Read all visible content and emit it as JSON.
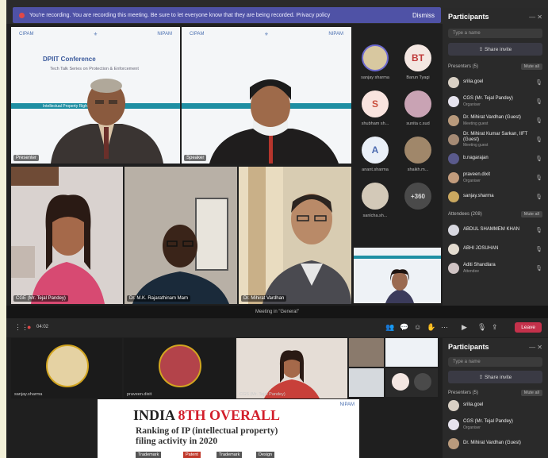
{
  "banner": {
    "text": "You're recording. You are recording this meeting. Be sure to let everyone know that they are being recorded. Privacy policy",
    "dismiss": "Dismiss"
  },
  "video_tiles": [
    {
      "name": "Presenter",
      "type": "slide"
    },
    {
      "name": "Speaker",
      "type": "slide"
    },
    {
      "name": "CGE (Mr. Tejal Pandey)",
      "type": "camera"
    },
    {
      "name": "Dr. M.K. Rajarathinam Mam",
      "type": "camera"
    },
    {
      "name": "Dr. Mihirat Vardhan",
      "type": "camera"
    }
  ],
  "slide_top": {
    "heading": "DPIIT Conference",
    "subtitle": "Tech Talk Series on Protection & Enforcement",
    "bar_label": "Intellectual Property Rights & Design Patent"
  },
  "avatars": [
    {
      "label": "sanjay sharma",
      "initials": "",
      "color": "#d8c8a0"
    },
    {
      "label": "Barun Tyagi",
      "initials": "BT",
      "color": "#f4e7e2"
    },
    {
      "label": "shubham sh...",
      "initials": "S",
      "color": "#f9e4df"
    },
    {
      "label": "sunita c.sud",
      "initials": "",
      "color": "#c9a3b4"
    },
    {
      "label": "anant.sharma",
      "initials": "A",
      "color": "#eaf0f8"
    },
    {
      "label": "shaikh.m...",
      "initials": "",
      "color": "#a0876a"
    },
    {
      "label": "sanlcha.sh...",
      "initials": "",
      "color": "#d3c9b8"
    },
    {
      "label": "+360",
      "initials": "+360",
      "color": "#4a4a4a"
    }
  ],
  "participants_panel": {
    "title": "Participants",
    "search_placeholder": "Type a name",
    "share_invite": "Share invite",
    "presenters_header": "Presenters (5)",
    "attendees_header": "Attendees (208)",
    "mute_all": "Mute all",
    "presenters": [
      {
        "name": "srilia.goel",
        "role": ""
      },
      {
        "name": "CGS (Mr. Tejal Pandey)",
        "role": "Organiser"
      },
      {
        "name": "Dr. Mihirat Vardhan (Guest)",
        "role": "Meeting guest"
      },
      {
        "name": "Dr. Mihirat Kumar Sarkan, IIFT (Guest)",
        "role": "Meeting guest"
      },
      {
        "name": "b.nagarajan",
        "role": ""
      },
      {
        "name": "praveen.dixit",
        "role": "Organiser"
      },
      {
        "name": "sanjay.sharma",
        "role": ""
      }
    ],
    "attendees": [
      {
        "name": "ABDUL SHAMMEM KHAN",
        "role": ""
      },
      {
        "name": "ABHI JOSUHAN",
        "role": ""
      },
      {
        "name": "Aditi Shandlara",
        "role": "Attendee"
      }
    ]
  },
  "meeting_divider": "Meeting in \"General\"",
  "lower_tiles": [
    {
      "name": "sanjay.sharma"
    },
    {
      "name": "praveen.dixit"
    },
    {
      "name": "CGS (Mr. Tejal Pandey)"
    }
  ],
  "lower_panel": {
    "title": "Participants",
    "search_placeholder": "Type a name",
    "share_invite": "Share invite",
    "presenters_header": "Presenters (5)",
    "mute_all": "Mute all",
    "presenters": [
      {
        "name": "srilia.goel",
        "role": ""
      },
      {
        "name": "CGS (Mr. Tejal Pandey)",
        "role": "Organiser"
      },
      {
        "name": "Dr. Mihirat Vardhan (Guest)",
        "role": ""
      }
    ]
  },
  "toolbar": {
    "time": "04:02",
    "leave": "Leave"
  },
  "slide_bottom": {
    "title_black": "INDIA ",
    "title_red": "8TH OVERALL",
    "subtitle": "Ranking of IP (intellectual property) filing activity in 2020",
    "tags": [
      "Trademark",
      "Patent",
      "Trademark",
      "Design"
    ]
  }
}
